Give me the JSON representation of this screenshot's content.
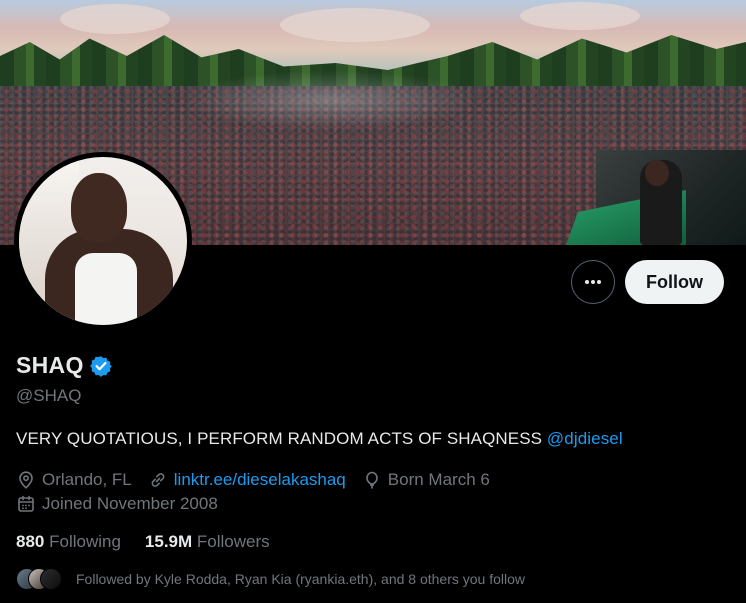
{
  "profile": {
    "name": "SHAQ",
    "handle": "@SHAQ",
    "bio_text": "VERY QUOTATIOUS, I PERFORM RANDOM ACTS OF SHAQNESS ",
    "bio_mention": "@djdiesel",
    "location": "Orlando, FL",
    "website": "linktr.ee/dieselakashaq",
    "birthday": "Born March 6",
    "joined": "Joined November 2008",
    "verified_color": "#1d9bf0"
  },
  "actions": {
    "more_icon": "more-horizontal-icon",
    "more_label": "•••",
    "follow_label": "Follow"
  },
  "stats": {
    "following_count": "880",
    "following_label": "Following",
    "followers_count": "15.9M",
    "followers_label": "Followers"
  },
  "followed_by": {
    "text": "Followed by Kyle Rodda, Ryan Kia (ryankia.eth), and 8 others you follow"
  },
  "colors": {
    "background": "#000000",
    "text_primary": "#e7e9ea",
    "text_secondary": "#71767b",
    "link": "#1d9bf0",
    "follow_button_bg": "#eff3f4"
  }
}
